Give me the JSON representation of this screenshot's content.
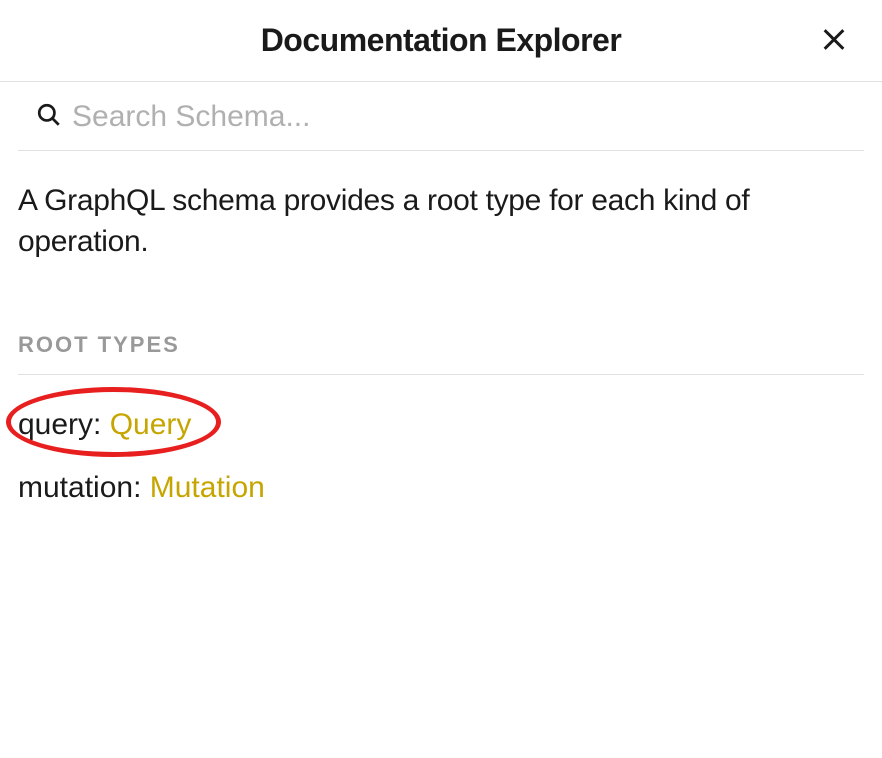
{
  "header": {
    "title": "Documentation Explorer"
  },
  "search": {
    "placeholder": "Search Schema..."
  },
  "description": "A GraphQL schema provides a root type for each kind of operation.",
  "section": {
    "heading": "ROOT TYPES",
    "items": [
      {
        "field": "query",
        "type": "Query",
        "highlighted": true
      },
      {
        "field": "mutation",
        "type": "Mutation",
        "highlighted": false
      }
    ]
  }
}
